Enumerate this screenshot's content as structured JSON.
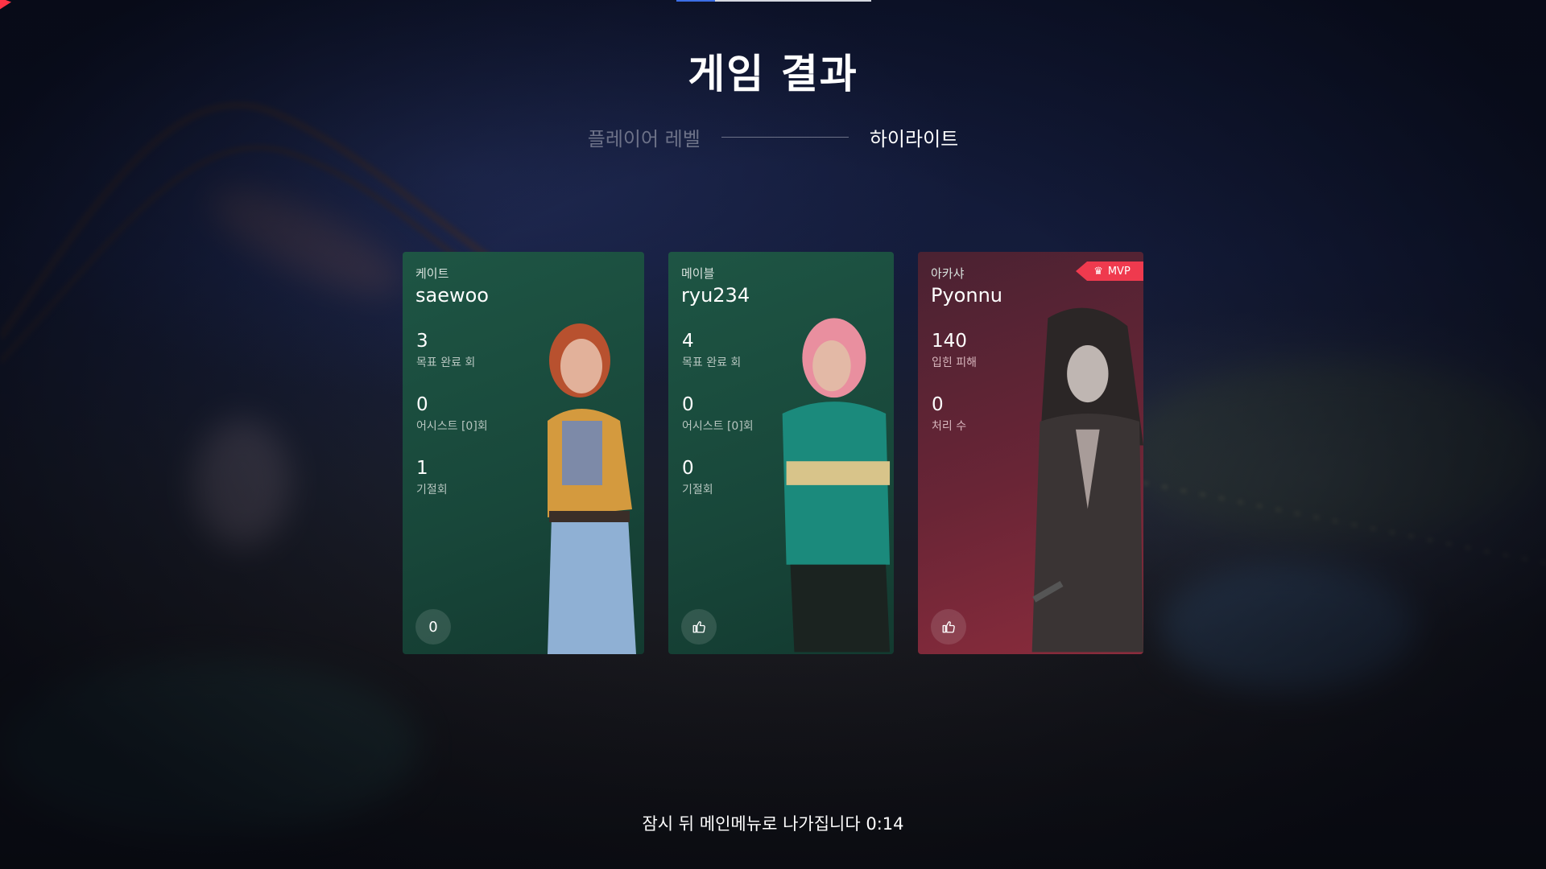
{
  "title": "게임 결과",
  "tabs": [
    {
      "label": "플레이어 레벨",
      "active": false
    },
    {
      "label": "하이라이트",
      "active": true
    }
  ],
  "progress": 0.2,
  "cards": [
    {
      "role": "케이트",
      "player": "saewoo",
      "color": "#1e5544",
      "stats": [
        {
          "value": "3",
          "label": "목표 완료 회"
        },
        {
          "value": "0",
          "label": "어시스트 [0]회"
        },
        {
          "value": "1",
          "label": "기절회"
        }
      ],
      "likes": "0",
      "mvp": false
    },
    {
      "role": "메이블",
      "player": "ryu234",
      "color": "#1e5544",
      "stats": [
        {
          "value": "4",
          "label": "목표 완료 회"
        },
        {
          "value": "0",
          "label": "어시스트 [0]회"
        },
        {
          "value": "0",
          "label": "기절회"
        }
      ],
      "likes_icon": "thumbs-up-icon",
      "mvp": false
    },
    {
      "role": "아카샤",
      "player": "Pyonnu",
      "color": "#6a2536",
      "stats": [
        {
          "value": "140",
          "label": "입힌 피해"
        },
        {
          "value": "0",
          "label": "처리 수"
        }
      ],
      "likes_icon": "thumbs-up-icon",
      "mvp": true,
      "mvp_label": "MVP"
    }
  ],
  "footer": "잠시 뒤 메인메뉴로 나가집니다 0:14",
  "colors": {
    "accent_red": "#ef3a4e",
    "green_card": "#1e5544",
    "red_card": "#6a2536",
    "progress_blue": "#3c6ee6"
  }
}
